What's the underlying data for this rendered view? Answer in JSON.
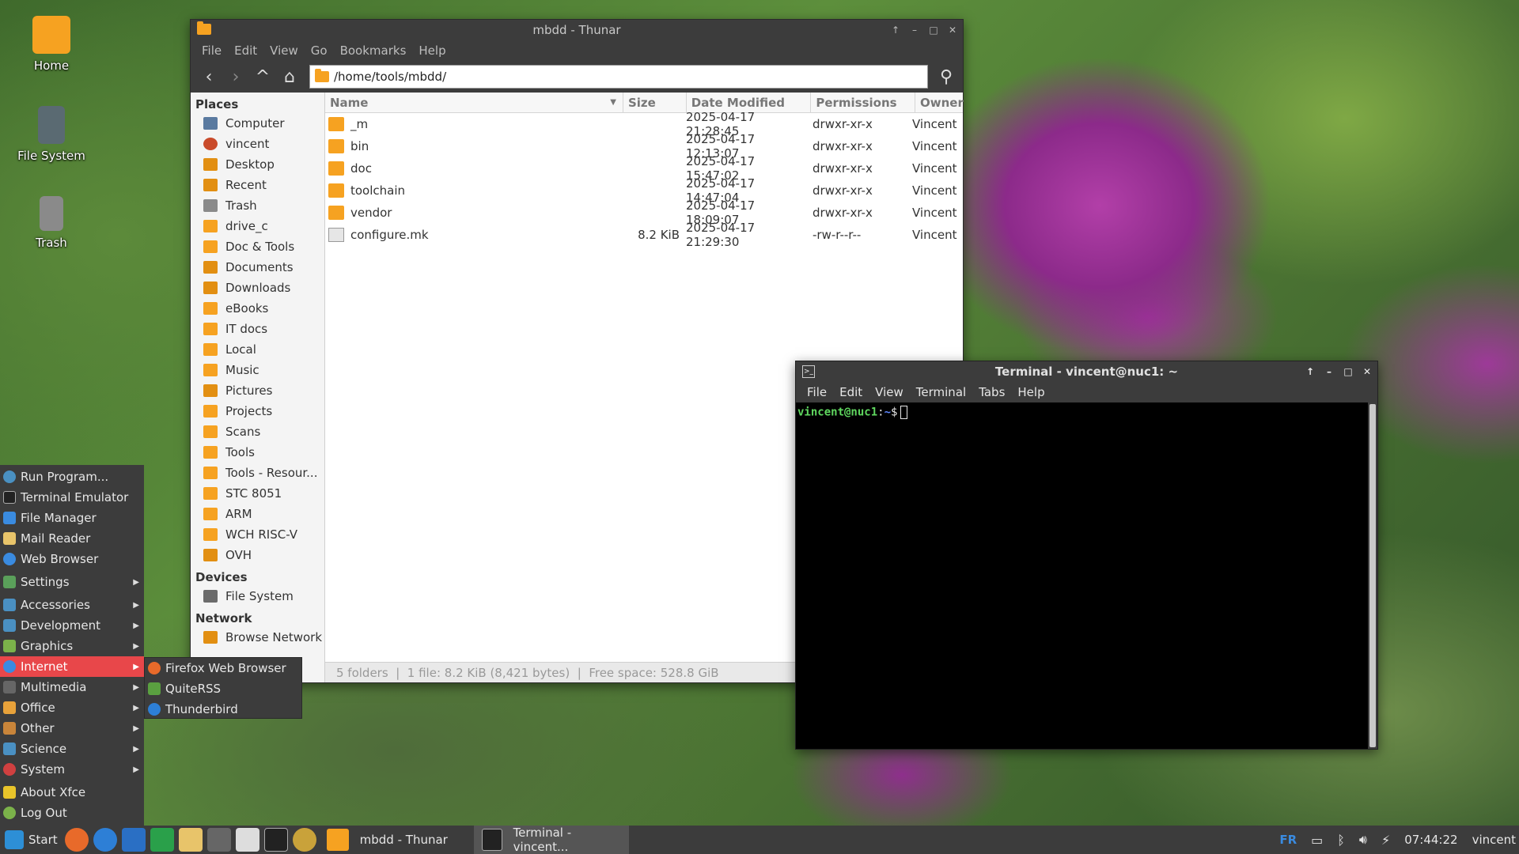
{
  "desktop": {
    "icons": [
      {
        "label": "Home"
      },
      {
        "label": "File System"
      },
      {
        "label": "Trash"
      }
    ]
  },
  "thunar": {
    "title": "mbdd - Thunar",
    "menu": [
      "File",
      "Edit",
      "View",
      "Go",
      "Bookmarks",
      "Help"
    ],
    "location": "/home/tools/mbdd/",
    "sidebar": {
      "places_heading": "Places",
      "places": [
        "Computer",
        "vincent",
        "Desktop",
        "Recent",
        "Trash",
        "drive_c",
        "Doc & Tools",
        "Documents",
        "Downloads",
        "eBooks",
        "IT docs",
        "Local",
        "Music",
        "Pictures",
        "Projects",
        "Scans",
        "Tools",
        "Tools - Resour...",
        "STC 8051",
        "ARM",
        "WCH RISC-V",
        "OVH"
      ],
      "devices_heading": "Devices",
      "devices": [
        "File System"
      ],
      "network_heading": "Network",
      "network": [
        "Browse Network"
      ]
    },
    "columns": [
      "Name",
      "Size",
      "Date Modified",
      "Permissions",
      "Owner"
    ],
    "files": [
      {
        "name": "_m",
        "size": "",
        "date": "2025-04-17 21:28:45",
        "perm": "drwxr-xr-x",
        "owner": "Vincent"
      },
      {
        "name": "bin",
        "size": "",
        "date": "2025-04-17 12:13:07",
        "perm": "drwxr-xr-x",
        "owner": "Vincent"
      },
      {
        "name": "doc",
        "size": "",
        "date": "2025-04-17 15:47:02",
        "perm": "drwxr-xr-x",
        "owner": "Vincent"
      },
      {
        "name": "toolchain",
        "size": "",
        "date": "2025-04-17 14:47:04",
        "perm": "drwxr-xr-x",
        "owner": "Vincent"
      },
      {
        "name": "vendor",
        "size": "",
        "date": "2025-04-17 18:09:07",
        "perm": "drwxr-xr-x",
        "owner": "Vincent"
      },
      {
        "name": "configure.mk",
        "size": "8.2 KiB",
        "date": "2025-04-17 21:29:30",
        "perm": "-rw-r--r--",
        "owner": "Vincent"
      }
    ],
    "status": "5 folders  |  1 file: 8.2 KiB (8,421 bytes)  |  Free space: 528.8 GiB"
  },
  "terminal": {
    "title": "Terminal - vincent@nuc1: ~",
    "menu": [
      "File",
      "Edit",
      "View",
      "Terminal",
      "Tabs",
      "Help"
    ],
    "prompt_user": "vincent@nuc1",
    "prompt_sep": ":",
    "prompt_path": "~",
    "prompt_end": "$"
  },
  "startmenu": {
    "top": [
      "Run Program...",
      "Terminal Emulator",
      "File Manager",
      "Mail Reader",
      "Web Browser"
    ],
    "settings": "Settings",
    "categories": [
      "Accessories",
      "Development",
      "Graphics",
      "Internet",
      "Multimedia",
      "Office",
      "Other",
      "Science",
      "System"
    ],
    "active_category": "Internet",
    "bottom": [
      "About Xfce",
      "Log Out"
    ],
    "submenu": [
      "Firefox Web Browser",
      "QuiteRSS",
      "Thunderbird"
    ]
  },
  "taskbar": {
    "start_label": "Start",
    "tasks": [
      "mbdd - Thunar",
      "Terminal - vincent..."
    ],
    "lang": "FR",
    "clock": "07:44:22",
    "user": "vincent"
  },
  "colors": {
    "accent": "#e8474a",
    "panel": "#3c3c3c",
    "folder": "#f6a221"
  }
}
